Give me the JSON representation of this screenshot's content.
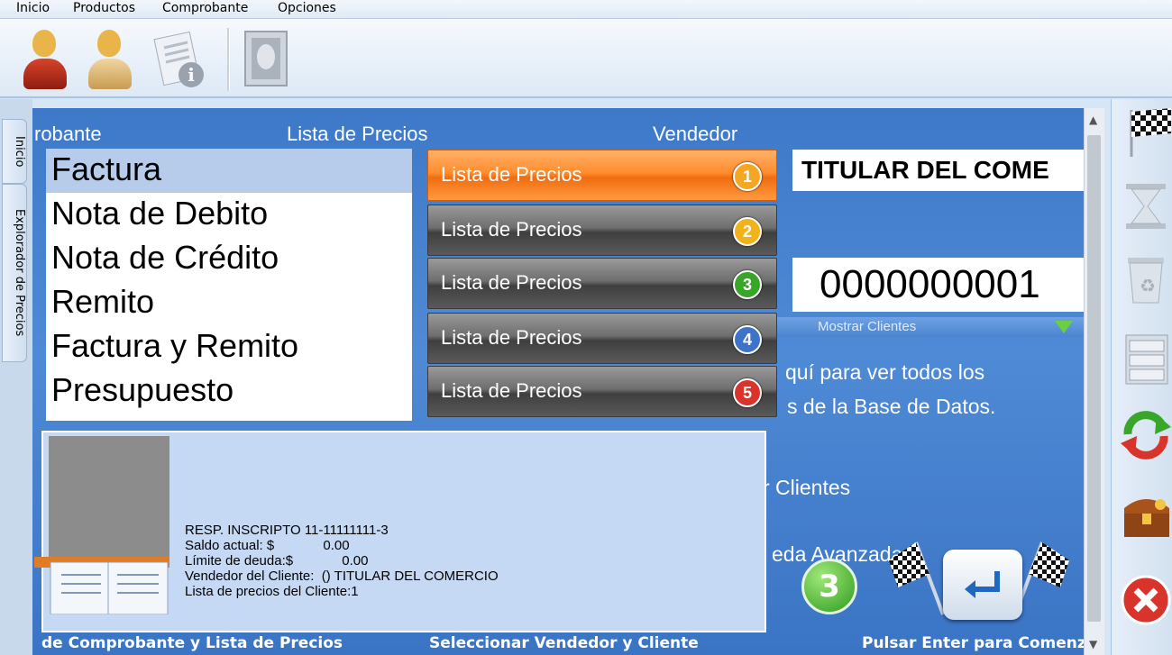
{
  "menu": {
    "items": [
      "Inicio",
      "Productos",
      "Comprobante",
      "Opciones"
    ]
  },
  "toolbar": {
    "icons": [
      "user-female-red-icon",
      "user-female-blue-icon",
      "document-info-icon",
      "stamp-icon"
    ]
  },
  "left_tabs": [
    "Inicio",
    "Explorador de Precios"
  ],
  "headers": {
    "comprobante": "robante",
    "lista_precios": "Lista de Precios",
    "vendedor": "Vendedor"
  },
  "doc_types": [
    "Factura",
    "Nota de Debito",
    "Nota de Crédito",
    "Remito",
    "Factura y Remito",
    "Presupuesto"
  ],
  "selected_doc_index": 0,
  "price_lists": [
    {
      "label": "Lista de Precios",
      "number": "1",
      "color": "#f5a623"
    },
    {
      "label": "Lista de Precios",
      "number": "2",
      "color": "#f2b21c"
    },
    {
      "label": "Lista de Precios",
      "number": "3",
      "color": "#39a62a"
    },
    {
      "label": "Lista de Precios",
      "number": "4",
      "color": "#3d73c9"
    },
    {
      "label": "Lista de Precios",
      "number": "5",
      "color": "#d8342b"
    }
  ],
  "selected_price_list_index": 0,
  "seller": "TITULAR DEL COME",
  "client_number": "0000000001",
  "show_clients_label": "Mostrar Clientes",
  "help": {
    "line1": "quí para ver todos los",
    "line2": "s de la Base de Datos.",
    "line3": "r Clientes",
    "line4": "eda Avanzada"
  },
  "client_card": {
    "lines": [
      "RESP. INSCRIPTO 11-11111111-3",
      "Saldo actual: $             0.00",
      "Límite de deuda:$             0.00",
      "Vendedor del Cliente:  () TITULAR DEL COMERCIO",
      "Lista de precios del Cliente:1"
    ]
  },
  "step_number": "3",
  "bottom": {
    "left": "de Comprobante y Lista de Precios",
    "middle": "Seleccionar Vendedor y Cliente",
    "right": "Pulsar Enter para Comenza"
  },
  "right_toolbar": {
    "icons": [
      "checkered-flag-icon",
      "hourglass-icon",
      "recycle-bin-icon",
      "cabinet-icon",
      "refresh-arrows-icon",
      "treasure-chest-icon",
      "close-icon"
    ]
  }
}
